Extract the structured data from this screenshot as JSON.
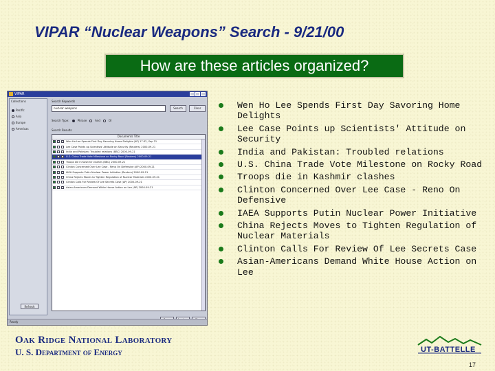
{
  "slide": {
    "title": "VIPAR “Nuclear Weapons” Search - 9/21/00",
    "question": "How are these articles organized?",
    "page_number": "17"
  },
  "app": {
    "window_title": "VIPAR",
    "collections_label": "Collections",
    "collections": [
      "Pacific",
      "Asia",
      "Europe",
      "Americas"
    ],
    "search_label": "Search Keywords",
    "search_value": "nuclear weapons",
    "search_button": "Search",
    "clear_button": "Clear",
    "search_type_label": "Search Type:",
    "search_types": [
      "Phrase",
      "And",
      "Or"
    ],
    "results_label": "Search Results",
    "results_header": "Documents Title",
    "results": [
      {
        "text": "Wen Ho Lee Spends First Day Savoring Home Delights (AP) 17:32, Sep 21",
        "checked": true,
        "selected": false
      },
      {
        "text": "Lee Case Points up Scientists' Attitude on Security (Reuters) 2000-09-21",
        "checked": true,
        "selected": false
      },
      {
        "text": "India and Pakistan: Troubled relations (BBC) 2000-09-21",
        "checked": true,
        "selected": false
      },
      {
        "text": "U.S. China Trade Vote Milestone on Rocky Road (Reuters) 2000-09-21",
        "checked": true,
        "selected": true
      },
      {
        "text": "Troops die in Kashmir clashes (BBC) 2000-09-21",
        "checked": true,
        "selected": false
      },
      {
        "text": "Clinton Concerned Over Lee Case - Reno On Defensive (AP) 2000-09-21",
        "checked": true,
        "selected": false
      },
      {
        "text": "IAEA Supports Putin Nuclear Power Initiative (Reuters) 2000-09-21",
        "checked": true,
        "selected": false
      },
      {
        "text": "China Rejects Moves to Tighten Regulation of Nuclear Materials 2000-09-21",
        "checked": true,
        "selected": false
      },
      {
        "text": "Clinton Calls For Review Of Lee Secrets Case (AP) 2000-09-21",
        "checked": true,
        "selected": false
      },
      {
        "text": "Asian-Americans Demand White House Action on Lee (AP) 2000-09-21",
        "checked": true,
        "selected": false
      }
    ],
    "left_button": "Refresh",
    "bottom_buttons": [
      "Open",
      "Analyze",
      "Close"
    ],
    "status": "Ready"
  },
  "articles": [
    "Wen Ho Lee Spends First Day Savoring Home Delights",
    "Lee Case Points up Scientists' Attitude on Security",
    "India and Pakistan: Troubled relations",
    "U.S. China Trade Vote Milestone on Rocky Road",
    "Troops die in Kashmir clashes",
    "Clinton Concerned Over Lee Case - Reno On Defensive",
    "IAEA Supports Putin Nuclear Power Initiative",
    "China Rejects Moves to Tighten Regulation of Nuclear Materials",
    "Clinton Calls For Review Of Lee Secrets Case",
    "Asian-Americans Demand White House Action on Lee"
  ],
  "footer": {
    "lab": "Oak Ridge National Laboratory",
    "department": "U. S. Department of Energy",
    "logo_text": "UT-BATTELLE"
  },
  "colors": {
    "background": "#f8f6d4",
    "title": "#1a2a80",
    "question_box": "#0a6b14",
    "bullet": "#1a7a1a"
  }
}
